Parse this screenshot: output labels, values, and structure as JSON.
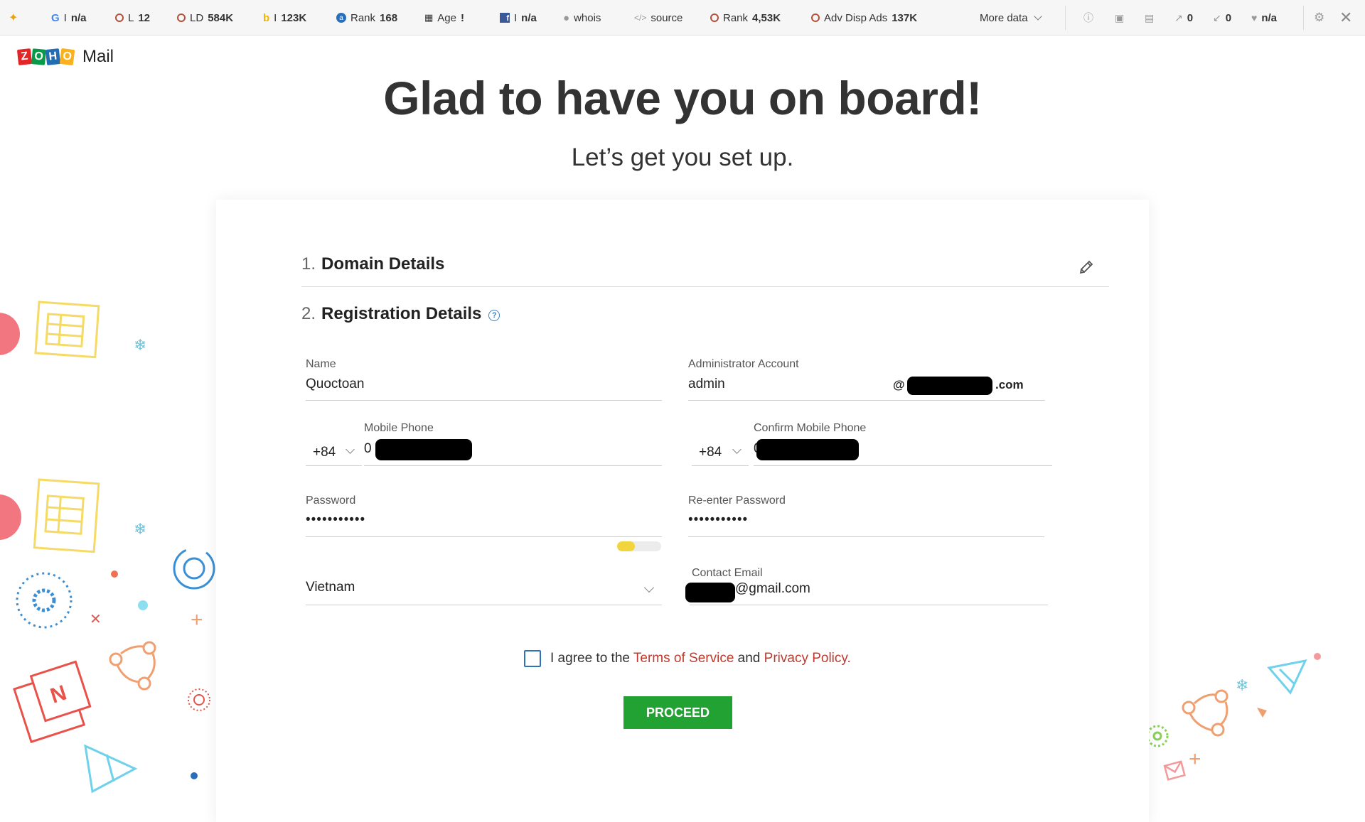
{
  "seo_toolbar": {
    "items": [
      {
        "icon": "google-icon",
        "label": "I",
        "value": "n/a"
      },
      {
        "icon": "links-ring-icon",
        "label": "L",
        "value": "12"
      },
      {
        "icon": "linking-domains-ring-icon",
        "label": "LD",
        "value": "584K"
      },
      {
        "icon": "bing-icon",
        "label": "I",
        "value": "123K"
      },
      {
        "icon": "alexa-icon",
        "label": "Rank",
        "value": "168"
      },
      {
        "icon": "calendar-icon",
        "label": "Age",
        "value": "!"
      },
      {
        "icon": "facebook-icon",
        "label": "I",
        "value": "n/a"
      },
      {
        "icon": "user-icon",
        "label": "whois",
        "value": ""
      },
      {
        "icon": "code-icon",
        "label": "source",
        "value": ""
      },
      {
        "icon": "rank-ring-icon",
        "label": "Rank",
        "value": "4,53K"
      },
      {
        "icon": "ads-ring-icon",
        "label": "Adv Disp Ads",
        "value": "137K"
      }
    ],
    "more_data": "More data",
    "counters": [
      {
        "icon": "external-link-icon",
        "value": "0"
      },
      {
        "icon": "internal-link-icon",
        "value": "0"
      },
      {
        "icon": "heart-icon",
        "value": "n/a"
      }
    ]
  },
  "brand": {
    "logo_letters": [
      "Z",
      "O",
      "H",
      "O"
    ],
    "product": "Mail"
  },
  "header": {
    "title": "Glad to have you on board!",
    "subtitle": "Let’s get you set up."
  },
  "steps": {
    "domain": {
      "number": "1.",
      "title": "Domain Details"
    },
    "registration": {
      "number": "2.",
      "title": "Registration Details",
      "help": "?"
    }
  },
  "form": {
    "name": {
      "label": "Name",
      "value": "Quoctoan"
    },
    "admin_account": {
      "label": "Administrator Account",
      "value": "admin",
      "domain_prefix": "@",
      "domain_suffix": ".com"
    },
    "mobile_phone": {
      "label": "Mobile Phone",
      "dial_code": "+84",
      "value_prefix": "0"
    },
    "confirm_mobile_phone": {
      "label": "Confirm Mobile Phone",
      "dial_code": "+84",
      "value_prefix": "0"
    },
    "password": {
      "label": "Password",
      "value": "•••••••••••",
      "strength": 0.4
    },
    "reenter_password": {
      "label": "Re-enter Password",
      "value": "•••••••••••"
    },
    "country": {
      "value": "Vietnam"
    },
    "contact_email": {
      "label": "Contact Email",
      "value_suffix": "@gmail.com"
    }
  },
  "agreement": {
    "prefix": "I agree to the",
    "terms": "Terms of Service",
    "and": "and",
    "privacy": "Privacy Policy",
    "period": "."
  },
  "proceed_label": "PROCEED",
  "colors": {
    "accent_green": "#22a233",
    "link_red": "#c0392b",
    "checkbox_blue": "#2f73bd",
    "strength_yellow": "#f2d53c"
  }
}
